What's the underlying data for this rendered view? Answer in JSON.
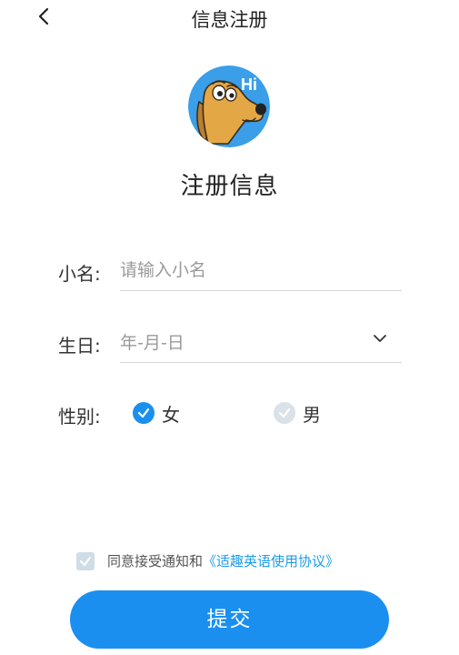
{
  "header": {
    "title": "信息注册"
  },
  "heading": "注册信息",
  "avatar": {
    "greeting": "Hi"
  },
  "form": {
    "nickname": {
      "label": "小名:",
      "placeholder": "请输入小名",
      "value": ""
    },
    "birthday": {
      "label": "生日:",
      "value": "年-月-日"
    },
    "gender": {
      "label": "性别:",
      "options": [
        {
          "label": "女",
          "selected": true
        },
        {
          "label": "男",
          "selected": false
        }
      ]
    }
  },
  "agreement": {
    "checked": true,
    "text": "同意接受通知和",
    "link": "《适趣英语使用协议》"
  },
  "submit_label": "提交",
  "colors": {
    "accent": "#1a8ff0",
    "link": "#1e9be8",
    "avatar_bg": "#3a9ee8"
  }
}
